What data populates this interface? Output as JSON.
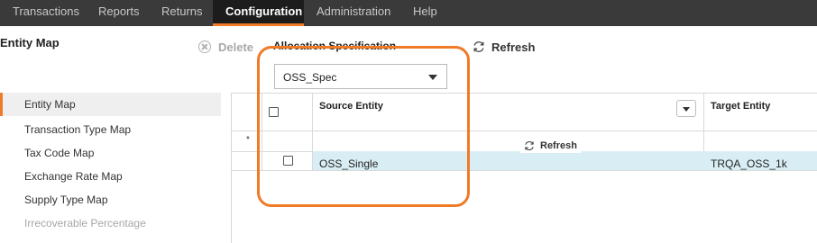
{
  "nav": {
    "tabs": [
      {
        "label": "Transactions"
      },
      {
        "label": "Reports"
      },
      {
        "label": "Returns"
      },
      {
        "label": "Configuration"
      },
      {
        "label": "Administration"
      },
      {
        "label": "Help"
      }
    ],
    "active_tab": "Configuration"
  },
  "page": {
    "title": "Entity Map"
  },
  "toolbar": {
    "delete_label": "Delete",
    "allocation_label": "Allocation Specification",
    "refresh_label": "Refresh"
  },
  "allocation_dropdown": {
    "selected": "OSS_Spec"
  },
  "sidebar": {
    "items": [
      {
        "label": "Entity Map"
      },
      {
        "label": "Transaction Type Map"
      },
      {
        "label": "Tax Code Map"
      },
      {
        "label": "Exchange Rate Map"
      },
      {
        "label": "Supply Type Map"
      },
      {
        "label": "Irrecoverable Percentage"
      }
    ],
    "active_item": "Entity Map"
  },
  "grid": {
    "columns": [
      {
        "label": "Source Entity"
      },
      {
        "label": "Target Entity"
      }
    ],
    "new_row_marker": "*",
    "refresh_label": "Refresh",
    "rows": [
      {
        "source": "OSS_Single",
        "target": "TRQA_OSS_1k"
      }
    ]
  },
  "colors": {
    "accent": "#f07a28",
    "nav_background": "#3a3a3a",
    "nav_active_background": "#1c1c1c",
    "selected_row": "#d9eef4"
  }
}
